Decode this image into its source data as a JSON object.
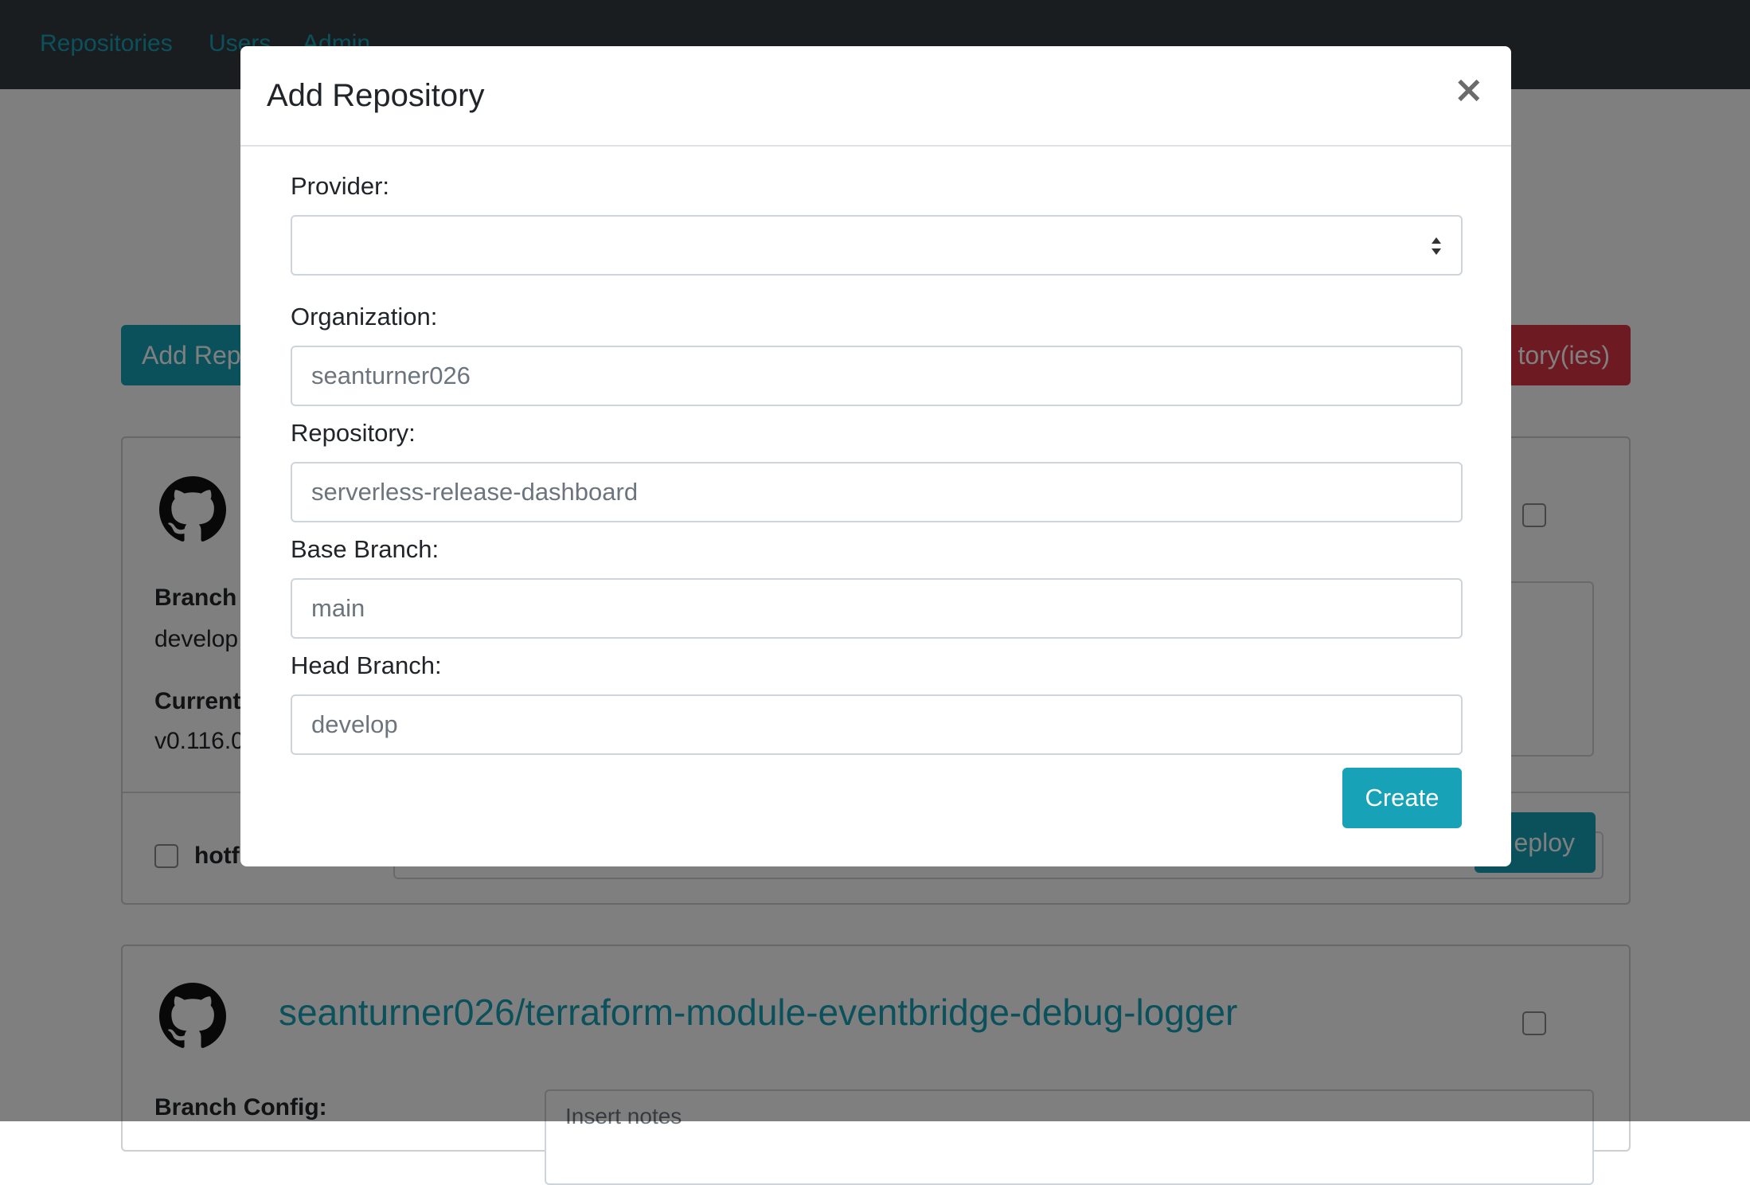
{
  "navbar": {
    "links": [
      "Repositories",
      "Users",
      "Admin"
    ]
  },
  "toolbar": {
    "add_repo_label": "Add Rep",
    "delete_label": "tory(ies)"
  },
  "repo_cards": [
    {
      "branch_label": "Branch",
      "branch_value": "develop",
      "current_label": "Current",
      "current_value": "v0.116.0",
      "hotfix_label": "hotf",
      "deploy_label": "eploy"
    },
    {
      "title": "seanturner026/terraform-module-eventbridge-debug-logger",
      "branch_label": "Branch Config:",
      "notes_placeholder": "Insert notes"
    }
  ],
  "modal": {
    "title": "Add Repository",
    "close_symbol": "×",
    "fields": {
      "provider": {
        "label": "Provider:",
        "value": ""
      },
      "organization": {
        "label": "Organization:",
        "placeholder": "seanturner026"
      },
      "repository": {
        "label": "Repository:",
        "placeholder": "serverless-release-dashboard"
      },
      "base_branch": {
        "label": "Base Branch:",
        "placeholder": "main"
      },
      "head_branch": {
        "label": "Head Branch:",
        "placeholder": "develop"
      }
    },
    "create_label": "Create"
  },
  "colors": {
    "accent": "#17a2b8",
    "danger": "#dc3545",
    "navbar": "#343a40"
  }
}
